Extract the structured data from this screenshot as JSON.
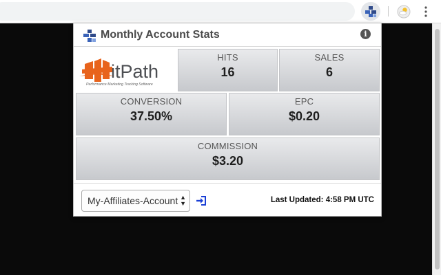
{
  "browser": {
    "toolbar_icons": [
      "extension-hitpath-icon",
      "weather-extension-icon",
      "chrome-menu-icon"
    ]
  },
  "popup": {
    "title": "Monthly Account Stats",
    "info_icon": "info-icon",
    "brand": {
      "name": "itPath",
      "tagline": "Performance Marketing Tracking Software",
      "colors": {
        "orange": "#e8631c",
        "gray": "#4d4f53"
      }
    },
    "stats": {
      "hits": {
        "label": "HITS",
        "value": "16"
      },
      "sales": {
        "label": "SALES",
        "value": "6"
      },
      "conversion": {
        "label": "CONVERSION",
        "value": "37.50%"
      },
      "epc": {
        "label": "EPC",
        "value": "$0.20"
      },
      "commission": {
        "label": "COMMISSION",
        "value": "$3.20"
      }
    },
    "footer": {
      "account_select": {
        "selected": "My-Affiliates-Account"
      },
      "login_icon": "sign-in-icon",
      "last_updated": "Last Updated: 4:58 PM UTC"
    }
  },
  "colors": {
    "link_blue": "#1a3fd6",
    "page_background": "#0d0d0d",
    "cell_gradient_top": "#e9eaec",
    "cell_gradient_bottom": "#c7c9cd"
  }
}
